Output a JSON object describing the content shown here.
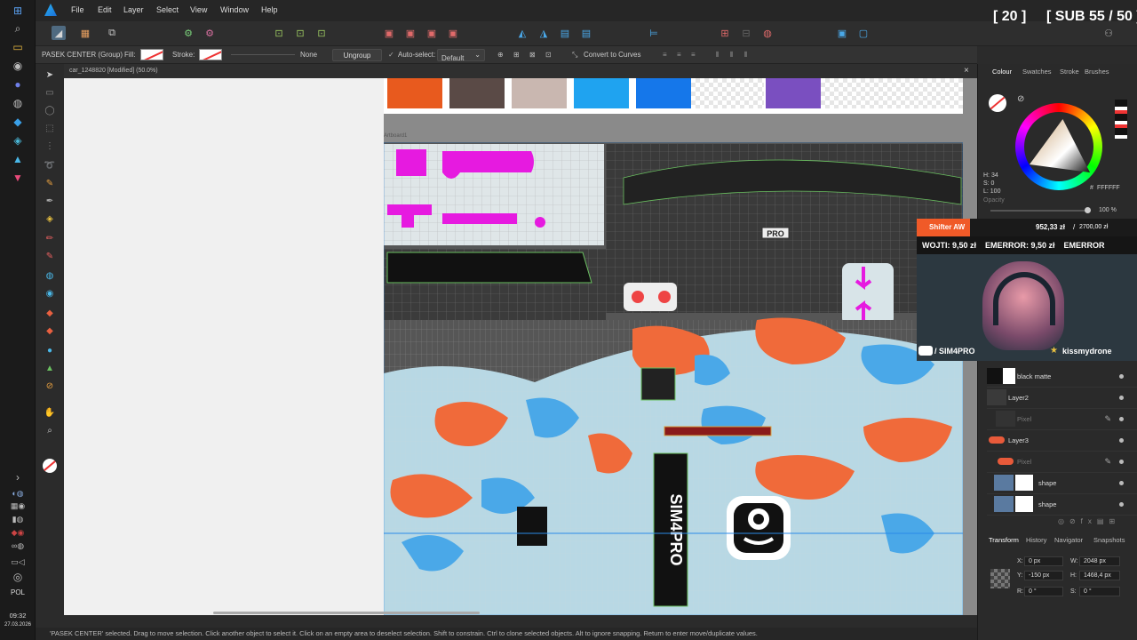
{
  "taskbar": {
    "language": "POL",
    "time": "09:32",
    "date": "27.03.2026"
  },
  "menu": {
    "items": [
      "File",
      "Edit",
      "Layer",
      "Select",
      "View",
      "Window",
      "Help"
    ]
  },
  "stream_overlay": {
    "count": "[ 20 ]",
    "subs": "[ SUB 55 / 50 ]",
    "donor_name": "Shifter AW",
    "donation_progress": "952,33 zł",
    "donation_goal": "2700,00 zł",
    "ticker": "WOJTI: 9,50 zł    EMERROR: 9,50 zł    EMERROR",
    "channel": "/ SIM4PRO",
    "streamer": "kissmydrone"
  },
  "context_toolbar": {
    "selection_name": "PASEK CENTER (Group)",
    "fill_label": "Fill:",
    "stroke_label": "Stroke:",
    "stroke_style": "None",
    "ungroup_label": "Ungroup",
    "autoselect_label": "Auto-select:",
    "autoselect_value": "Default",
    "convert_label": "Convert to Curves"
  },
  "document": {
    "tab_title": "car_1248820 [Modified] (50.0%)",
    "artboard_label": "Artboard1",
    "pro_label": "PRO",
    "sim4pro_text": "SIM4PRO"
  },
  "colors": {
    "swatches": [
      "#e85a1e",
      "#5a4a46",
      "#c9b7b0",
      "#1fa3f0",
      "#1577ea",
      "#ffffff",
      "#7a4fc0"
    ],
    "magenta": "#e61ae0",
    "camo_orange": "#f06a3a",
    "camo_blue": "#4aa8e8",
    "camo_light": "#b8d8e4"
  },
  "panel": {
    "tabs": [
      "Colour",
      "Swatches",
      "Stroke",
      "Brushes"
    ],
    "hex_value": "FFFFFF",
    "hsl": {
      "h": "H: 34",
      "s": "S: 0",
      "l": "L: 100"
    },
    "opacity_label": "Opacity",
    "opacity_value": "100 %",
    "layers": [
      {
        "name": "black matte"
      },
      {
        "name": "Layer2"
      },
      {
        "name": "Pixel"
      },
      {
        "name": "Layer3"
      },
      {
        "name": "Pixel"
      },
      {
        "name": "shape"
      },
      {
        "name": "shape"
      }
    ],
    "bottom_tabs": [
      "Transform",
      "History",
      "Navigator",
      "Snapshots"
    ],
    "transform": {
      "x": "0 px",
      "y": "-150 px",
      "w": "2048 px",
      "h": "1468,4 px",
      "r": "0 °",
      "s": "0 °"
    }
  },
  "status_bar": {
    "text": "'PASEK CENTER' selected. Drag to move selection. Click another object to select it. Click on an empty area to deselect selection. Shift to constrain. Ctrl to clone selected objects. Alt to ignore snapping. Return to enter move/duplicate values."
  }
}
